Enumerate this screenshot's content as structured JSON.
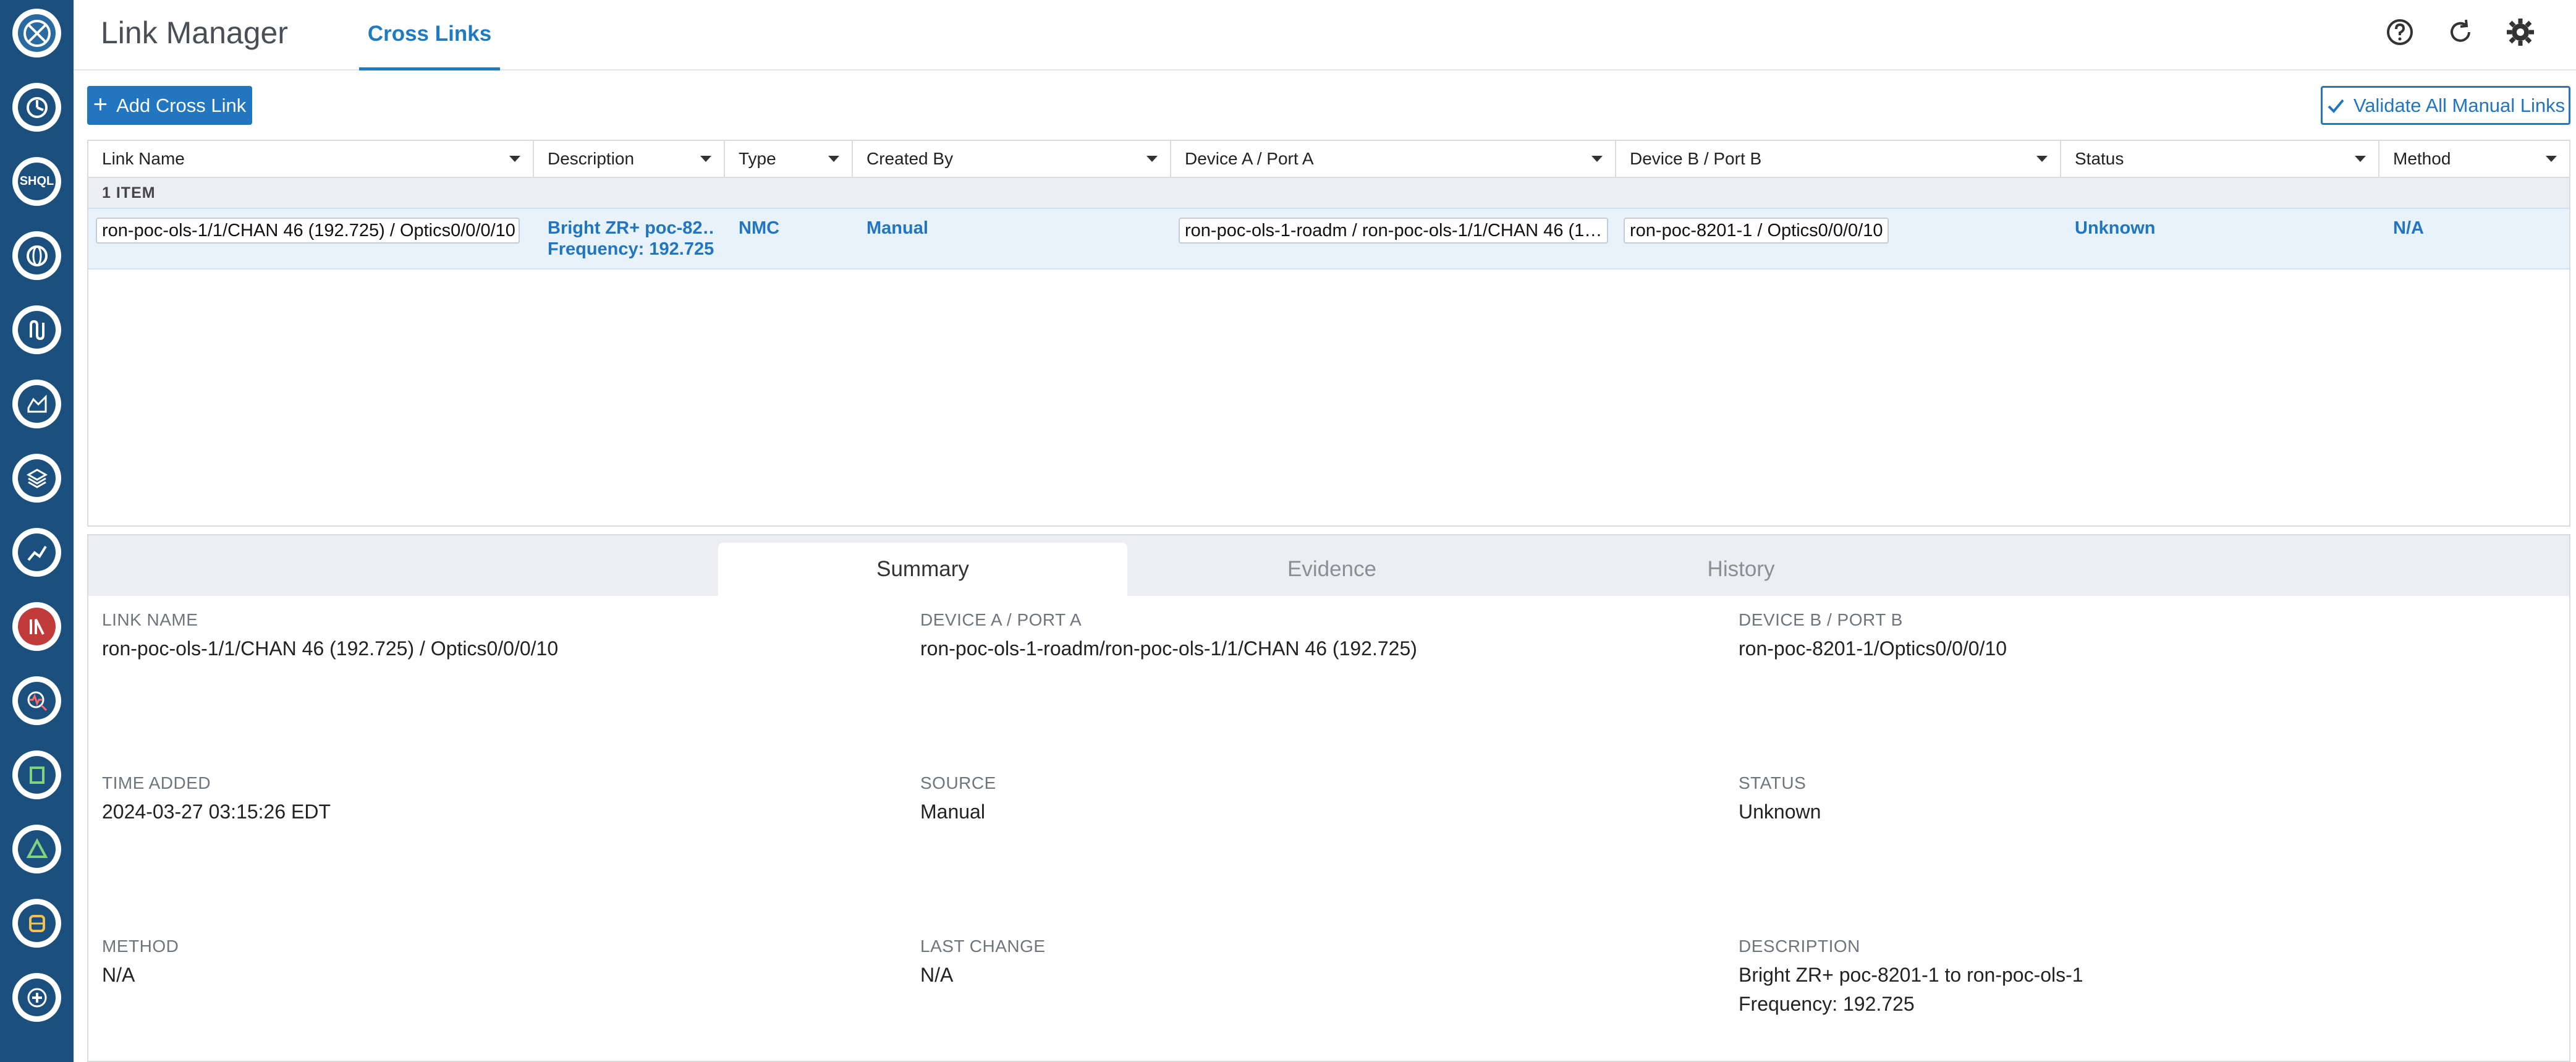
{
  "rail": {
    "icons": [
      "app-logo-icon",
      "dashboard-icon",
      "shql-icon",
      "network-globe-icon",
      "path-icon",
      "map-icon",
      "layers-icon",
      "analytics-icon",
      "reports-icon",
      "monitor-icon",
      "inventory-icon",
      "topology-icon",
      "transit-icon",
      "add-source-icon"
    ],
    "shql_label": "SHQL"
  },
  "header": {
    "title": "Link Manager",
    "active_tab": "Cross Links",
    "icons": [
      "help-icon",
      "refresh-icon",
      "settings-icon"
    ]
  },
  "toolbar": {
    "add_label": "Add Cross Link",
    "validate_label": "Validate All Manual Links"
  },
  "grid": {
    "columns": [
      "Link Name",
      "Description",
      "Type",
      "Created By",
      "Device A / Port A",
      "Device B / Port B",
      "Status",
      "Method"
    ],
    "group_label": "1 ITEM",
    "rows": [
      {
        "link_name": "ron-poc-ols-1/1/CHAN 46 (192.725) / Optics0/0/0/10",
        "description_line1": "Bright ZR+ poc-82…",
        "description_line2": "Frequency: 192.725",
        "type": "NMC",
        "created_by": "Manual",
        "device_a": "ron-poc-ols-1-roadm / ron-poc-ols-1/1/CHAN 46 (1…",
        "device_b": "ron-poc-8201-1 / Optics0/0/0/10",
        "status": "Unknown",
        "method": "N/A"
      }
    ]
  },
  "details": {
    "tabs": [
      "Summary",
      "Evidence",
      "History"
    ],
    "fields": {
      "link_name": {
        "label": "LINK NAME",
        "value": "ron-poc-ols-1/1/CHAN 46 (192.725) / Optics0/0/0/10"
      },
      "device_a": {
        "label": "DEVICE A / PORT A",
        "value": "ron-poc-ols-1-roadm/ron-poc-ols-1/1/CHAN 46 (192.725)"
      },
      "device_b": {
        "label": "DEVICE B / PORT B",
        "value": "ron-poc-8201-1/Optics0/0/0/10"
      },
      "time_added": {
        "label": "TIME ADDED",
        "value": "2024-03-27 03:15:26 EDT"
      },
      "source": {
        "label": "SOURCE",
        "value": "Manual"
      },
      "status": {
        "label": "STATUS",
        "value": "Unknown"
      },
      "method": {
        "label": "METHOD",
        "value": "N/A"
      },
      "last_change": {
        "label": "LAST CHANGE",
        "value": "N/A"
      },
      "description": {
        "label": "DESCRIPTION",
        "value_line1": "Bright ZR+ poc-8201-1 to ron-poc-ols-1",
        "value_line2": "Frequency: 192.725"
      }
    }
  },
  "colors": {
    "rail": "#1b4f7e",
    "accent": "#2275bf",
    "selected_row": "#e8f2fb"
  }
}
